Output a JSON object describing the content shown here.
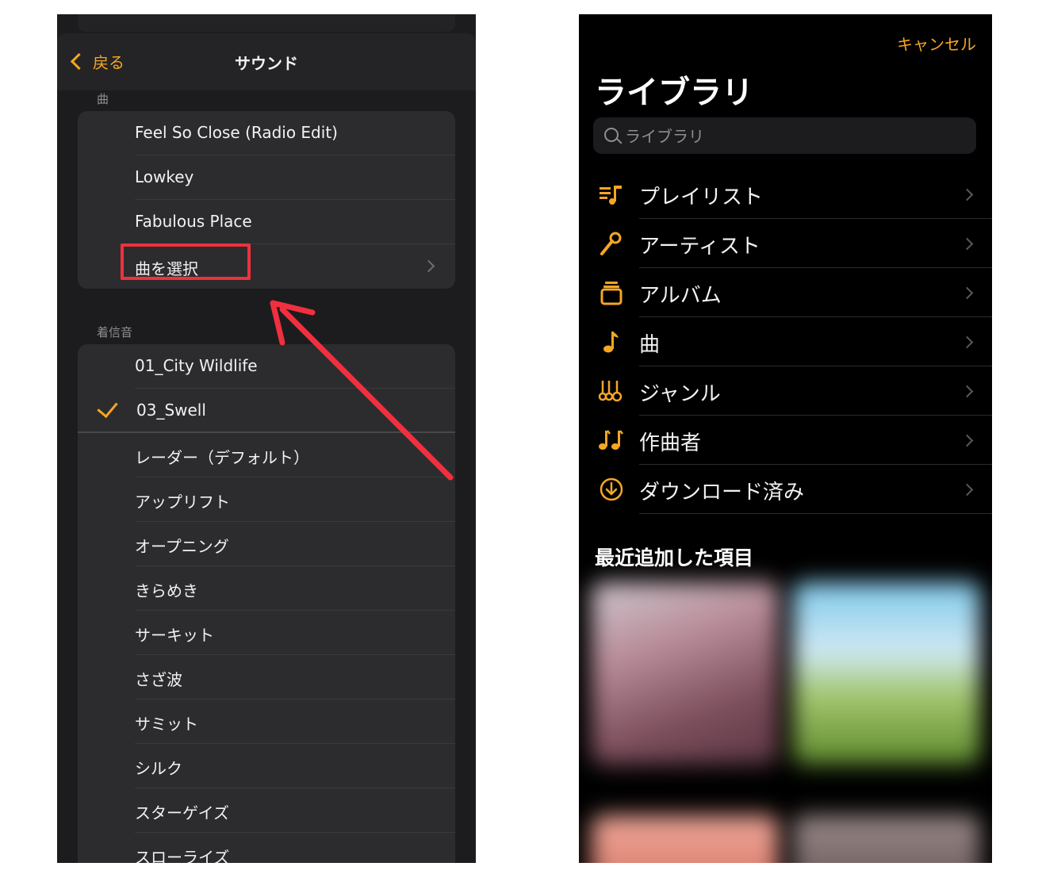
{
  "left": {
    "nav": {
      "back_label": "戻る",
      "title": "サウンド"
    },
    "songs_header": "曲",
    "songs": [
      "Feel So Close (Radio Edit)",
      "Lowkey",
      "Fabulous Place"
    ],
    "choose_song": "曲を選択",
    "ringtones_header": "着信音",
    "ringtones": [
      "01_City Wildlife",
      "03_Swell"
    ],
    "selected_ringtone": "03_Swell",
    "classic_tones": [
      "レーダー（デフォルト）",
      "アップリフト",
      "オープニング",
      "きらめき",
      "サーキット",
      "さざ波",
      "サミット",
      "シルク",
      "スターゲイズ",
      "スローライズ"
    ]
  },
  "right": {
    "cancel_label": "キャンセル",
    "title": "ライブラリ",
    "search_placeholder": "ライブラリ",
    "items": [
      {
        "label": "プレイリスト",
        "icon": "playlist-icon"
      },
      {
        "label": "アーティスト",
        "icon": "microphone-icon"
      },
      {
        "label": "アルバム",
        "icon": "album-icon"
      },
      {
        "label": "曲",
        "icon": "music-note-icon"
      },
      {
        "label": "ジャンル",
        "icon": "genre-icon"
      },
      {
        "label": "作曲者",
        "icon": "composer-icon"
      },
      {
        "label": "ダウンロード済み",
        "icon": "download-icon"
      }
    ],
    "recent_title": "最近追加した項目"
  },
  "colors": {
    "accent": "#f5a623",
    "annotation": "#f0303e"
  }
}
